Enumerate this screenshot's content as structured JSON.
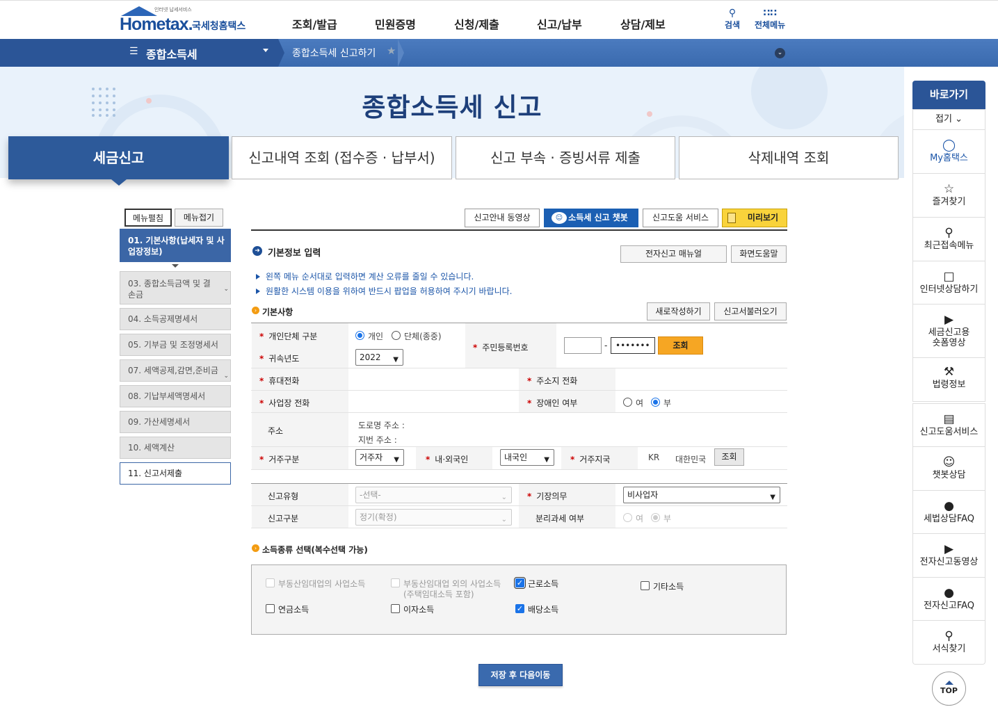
{
  "header": {
    "logo_small": "인터넷 납세서비스",
    "logo_main": "Hometax.",
    "logo_sub": "국세청홈택스",
    "nav": [
      "조회/발급",
      "민원증명",
      "신청/제출",
      "신고/납부",
      "상담/제보"
    ],
    "search_label": "검색",
    "allmenu_label": "전체메뉴"
  },
  "location": {
    "menu_title": "종합소득세",
    "current": "종합소득세 신고하기"
  },
  "hero": {
    "title": "종합소득세 신고"
  },
  "tabs": [
    "세금신고",
    "신고내역 조회 (접수증 · 납부서)",
    "신고 부속 · 증빙서류 제출",
    "삭제내역 조회"
  ],
  "leftmenu": {
    "expand": "메뉴펼침",
    "collapse": "메뉴접기",
    "items": [
      "01. 기본사항(납세자 및 사업장정보)",
      "03. 종합소득금액 및 결손금",
      "04. 소득공제명세서",
      "05. 기부금 및 조정명세서",
      "07. 세액공제,감면,준비금",
      "08. 기납부세액명세서",
      "09. 가산세명세서",
      "10. 세액계산",
      "11. 신고서제출"
    ]
  },
  "toolbar": {
    "video": "신고안내 동영상",
    "chatbot": "소득세 신고 챗봇",
    "help_service": "신고도움 서비스",
    "preview": "미리보기"
  },
  "section": {
    "title": "기본정보 입력",
    "manual_btn": "전자신고 매뉴얼",
    "screen_help_btn": "화면도움말",
    "info1": "왼쪽 메뉴 순서대로 입력하면 계산 오류를 줄일 수 있습니다.",
    "info2": "원활한 시스템 이용을 위하여 반드시 팝업을 허용하여 주시기 바랍니다."
  },
  "basic": {
    "title": "기본사항",
    "new_btn": "새로작성하기",
    "load_btn": "신고서불러오기",
    "person_type_label": "개인단체 구분",
    "person_opt1": "개인",
    "person_opt2": "단체(종중)",
    "year_label": "귀속년도",
    "year_value": "2022",
    "rrn_label": "주민등록번호",
    "rrn_front": "",
    "rrn_back": "•••••••",
    "rrn_dash": "-",
    "lookup_btn": "조회",
    "mobile_label": "휴대전화",
    "home_phone_label": "주소지 전화",
    "biz_phone_label": "사업장 전화",
    "disabled_label": "장애인 여부",
    "yes": "여",
    "no": "부",
    "address_label": "주소",
    "road_addr": "도로명 주소 :",
    "jibun_addr": "지번 주소 :",
    "residence_label": "거주구분",
    "residence_value": "거주자",
    "nationality_label": "내·외국인",
    "nationality_value": "내국인",
    "country_label": "거주지국",
    "country_code": "KR",
    "country_name": "대한민국",
    "country_btn": "조회"
  },
  "report": {
    "type_label": "신고유형",
    "type_value": "-선택-",
    "bookkeeping_label": "기장의무",
    "bookkeeping_value": "비사업자",
    "category_label": "신고구분",
    "category_value": "정기(확정)",
    "separate_label": "분리과세 여부",
    "yes": "여",
    "no": "부"
  },
  "income": {
    "title": "소득종류 선택(복수선택 가능)",
    "items": [
      "부동산임대업의 사업소득",
      "부동산임대업 외의 사업소득",
      "(주택임대소득 포함)",
      "근로소득",
      "기타소득",
      "연금소득",
      "이자소득",
      "배당소득"
    ]
  },
  "save_btn": "저장 후 다음이동",
  "quick": {
    "title": "바로가기",
    "fold": "접기",
    "items": [
      "My홈택스",
      "즐겨찾기",
      "최근접속메뉴",
      "인터넷상담하기",
      "세금신고용",
      "숏폼영상",
      "법령정보",
      "신고도움서비스",
      "챗봇상담",
      "세법상담FAQ",
      "전자신고동영상",
      "전자신고FAQ",
      "서식찾기"
    ],
    "top": "TOP"
  }
}
